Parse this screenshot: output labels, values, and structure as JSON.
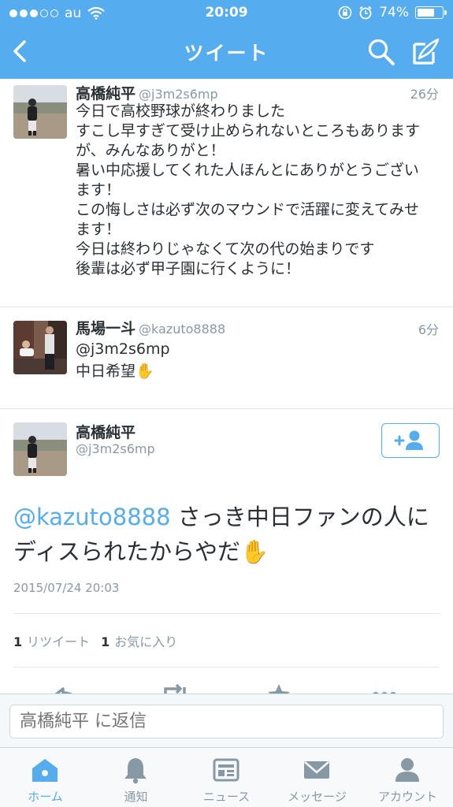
{
  "status_bar": {
    "carrier": "au",
    "time": "20:09",
    "battery": "74%",
    "battery_level": 0.74
  },
  "nav": {
    "title": "ツイート"
  },
  "tweets": [
    {
      "name": "高橋純平",
      "handle": "@j3m2s6mp",
      "time": "26分",
      "text": "今日で高校野球が終わりました\nすこし早すぎて受け止められないところもあります\nが、みんなありがと！\n暑い中応援してくれた人ほんとにありがとうござい\nます！\nこの悔しさは必ず次のマウンドで活躍に変えてみせ\nます！\n今日は終わりじゃなくて次の代の始まりです\n後輩は必ず甲子園に行くように！"
    },
    {
      "name": "馬場一斗",
      "handle": "@kazuto8888",
      "time": "6分",
      "text": "@j3m2s6mp\n中日希望✋"
    }
  ],
  "main_tweet": {
    "name": "高橋純平",
    "handle": "@j3m2s6mp",
    "mention": "@kazuto8888",
    "text": " さっき中日ファンの人にディスられたからやだ✋",
    "date": "2015/07/24 20:03",
    "retweet_count": "1",
    "retweet_label": "リツイート",
    "fav_count": "1",
    "fav_label": "お気に入り"
  },
  "reply": {
    "placeholder": "高橋純平 に返信"
  },
  "tabs": [
    {
      "label": "ホーム",
      "icon": "home-icon",
      "active": true
    },
    {
      "label": "通知",
      "icon": "bell-icon",
      "active": false
    },
    {
      "label": "ニュース",
      "icon": "news-icon",
      "active": false
    },
    {
      "label": "メッセージ",
      "icon": "envelope-icon",
      "active": false
    },
    {
      "label": "アカウント",
      "icon": "person-icon",
      "active": false
    }
  ],
  "colors": {
    "brand": "#55acee",
    "text": "#292f33",
    "muted": "#8899a6",
    "border": "#e1e8ed"
  }
}
